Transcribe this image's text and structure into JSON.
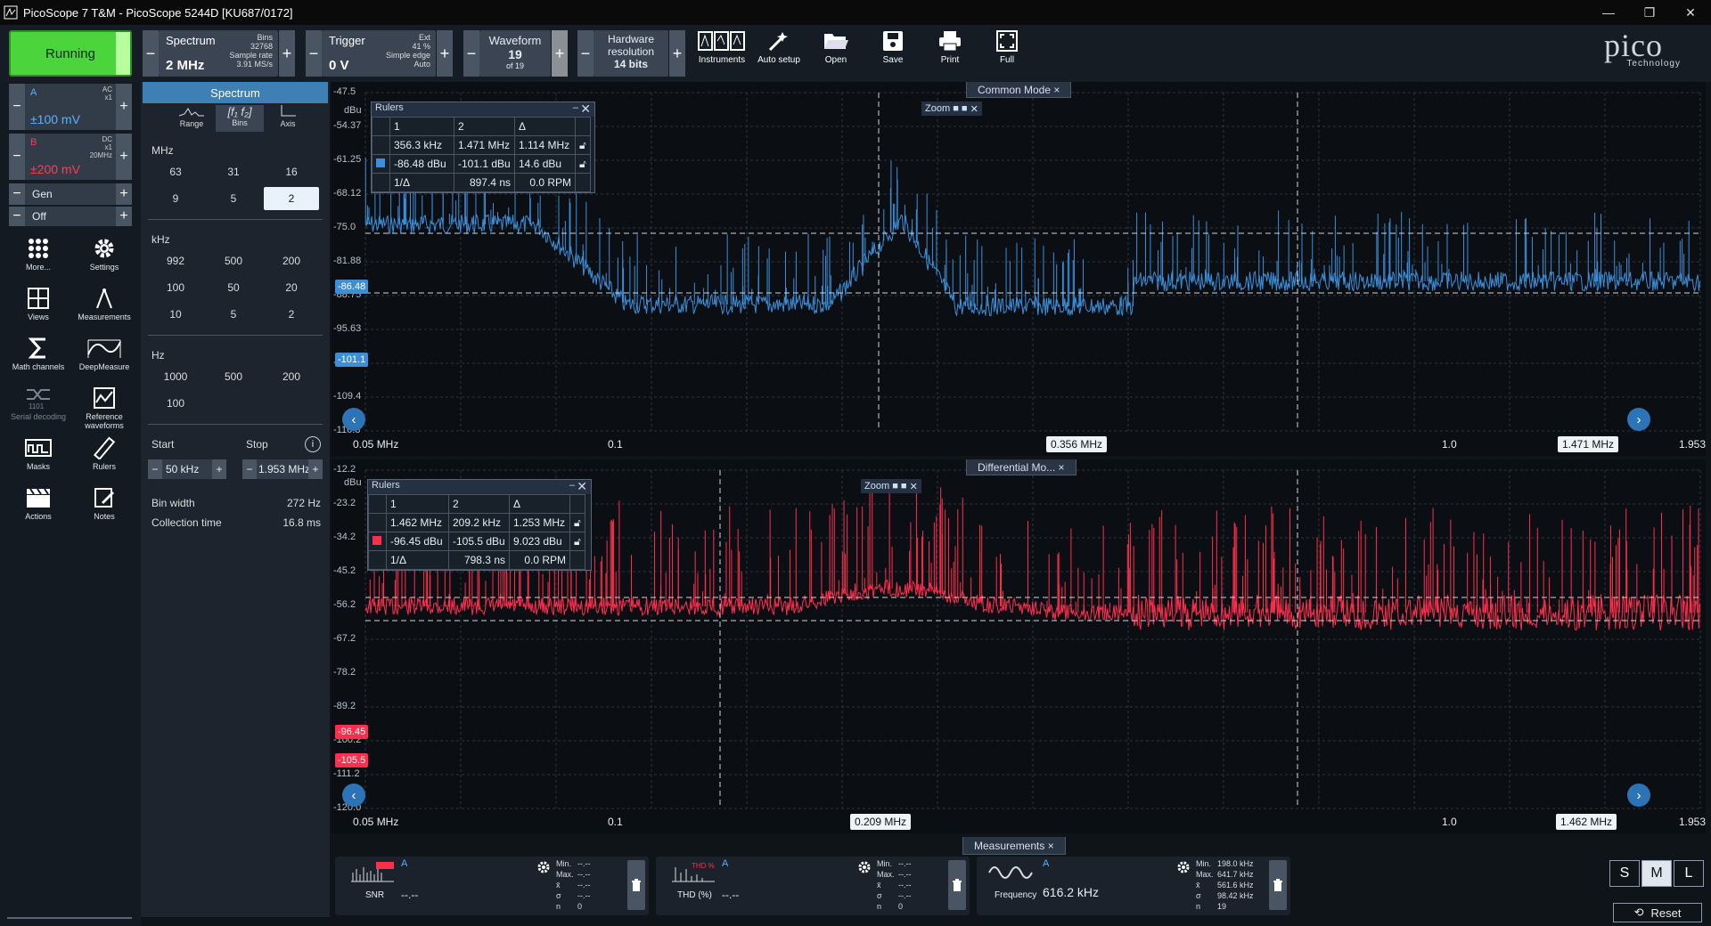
{
  "window": {
    "title": "PicoScope 7 T&M - PicoScope 5244D [KU687/0172]"
  },
  "toolbar": {
    "run": "Running",
    "spectrum": {
      "label": "Spectrum",
      "value": "2 MHz",
      "bins_lbl": "Bins",
      "bins": "32768",
      "rate_lbl": "Sample rate",
      "rate": "3.91 MS/s"
    },
    "trigger": {
      "label": "Trigger",
      "value": "0 V",
      "ext": "Ext",
      "pct": "41 %",
      "edge": "Simple edge",
      "mode": "Auto"
    },
    "waveform": {
      "label": "Waveform",
      "value": "19",
      "of": "of 19"
    },
    "hwres": {
      "label1": "Hardware",
      "label2": "resolution",
      "value": "14 bits"
    },
    "icons": [
      "Instruments",
      "Auto setup",
      "Open",
      "Save",
      "Print",
      "Full"
    ],
    "logo": "pico",
    "logo_sub": "Technology"
  },
  "channels": {
    "a": {
      "name": "A",
      "coupling": "AC",
      "probe": "x1",
      "range": "±100 mV"
    },
    "b": {
      "name": "B",
      "coupling": "DC",
      "probe": "x1",
      "bw": "20MHz",
      "range": "±200 mV"
    },
    "gen": "Gen",
    "off": "Off"
  },
  "nav": [
    "More...",
    "Settings",
    "Views",
    "Measurements",
    "Math channels",
    "DeepMeasure",
    "Serial decoding",
    "Reference waveforms",
    "Masks",
    "Rulers",
    "Actions",
    "Notes"
  ],
  "spectrum_panel": {
    "title": "Spectrum",
    "tabs": [
      "Range",
      "Bins",
      "Axis"
    ],
    "mhz_label": "MHz",
    "mhz": [
      "63",
      "31",
      "16",
      "9",
      "5",
      "2"
    ],
    "khz_label": "kHz",
    "khz": [
      "992",
      "500",
      "200",
      "100",
      "50",
      "20",
      "10",
      "5",
      "2"
    ],
    "hz_label": "Hz",
    "hz": [
      "1000",
      "500",
      "200",
      "100"
    ],
    "start_label": "Start",
    "stop_label": "Stop",
    "start": "50 kHz",
    "stop": "1.953 MHz",
    "binwidth_label": "Bin width",
    "binwidth": "272 Hz",
    "coll_label": "Collection time",
    "coll": "16.8 ms"
  },
  "top_view": {
    "tab": "Common Mode",
    "yunit": "dBu",
    "yticks": [
      "-47.5",
      "-54.37",
      "-61.25",
      "-68.12",
      "-75.0",
      "-81.88",
      "-88.75",
      "-95.63",
      "-102.5",
      "-109.4",
      "-116.3"
    ],
    "xticks": [
      "0.05 MHz",
      "0.1",
      "1.0",
      "1.953"
    ],
    "ruler_tags": {
      "x1": "0.356 MHz",
      "x2": "1.471 MHz",
      "y1": "-86.48",
      "y2": "-101.1"
    },
    "rulers": {
      "title": "Rulers",
      "h": [
        "1",
        "2",
        "Δ"
      ],
      "f": [
        "356.3 kHz",
        "1.471 MHz",
        "1.114 MHz"
      ],
      "a": [
        "-86.48 dBu",
        "-101.1 dBu",
        "14.6 dBu"
      ],
      "inv": [
        "1/Δ",
        "897.4 ns",
        "0.0 RPM"
      ]
    },
    "zoom": "Zoom",
    "color": "#3b8fd9"
  },
  "bottom_view": {
    "tab": "Differential Mo...",
    "yunit": "dBu",
    "yticks": [
      "-12.2",
      "-23.2",
      "-34.2",
      "-45.2",
      "-56.2",
      "-67.2",
      "-78.2",
      "-89.2",
      "-100.2",
      "-111.2",
      "-120.0"
    ],
    "xticks": [
      "0.05 MHz",
      "0.1",
      "1.0",
      "1.953"
    ],
    "ruler_tags": {
      "x1": "0.209 MHz",
      "x2": "1.462 MHz",
      "y1": "-96.45",
      "y2": "-105.5"
    },
    "rulers": {
      "title": "Rulers",
      "h": [
        "1",
        "2",
        "Δ"
      ],
      "f": [
        "1.462 MHz",
        "209.2 kHz",
        "1.253 MHz"
      ],
      "a": [
        "-96.45 dBu",
        "-105.5 dBu",
        "9.023 dBu"
      ],
      "inv": [
        "1/Δ",
        "798.3 ns",
        "0.0 RPM"
      ]
    },
    "zoom": "Zoom",
    "color": "#ff2e4d"
  },
  "measurements": {
    "tab": "Measurements",
    "items": [
      {
        "name": "SNR",
        "ch": "A",
        "value": "--.--",
        "stats": [
          "Min.",
          "Max.",
          "x̄",
          "σ",
          "n"
        ],
        "vals": [
          "--.--",
          "--.--",
          "--.--",
          "--.--",
          "0"
        ]
      },
      {
        "name": "THD (%)",
        "ch": "A",
        "value": "--.--",
        "stats": [
          "Min.",
          "Max.",
          "x̄",
          "σ",
          "n"
        ],
        "vals": [
          "--.--",
          "--.--",
          "--.--",
          "--.--",
          "0"
        ]
      },
      {
        "name": "Frequency",
        "ch": "A",
        "value": "616.2 kHz",
        "stats": [
          "Min.",
          "Max.",
          "x̄",
          "σ",
          "n"
        ],
        "vals": [
          "198.0 kHz",
          "641.7 kHz",
          "561.6 kHz",
          "98.42 kHz",
          "19"
        ]
      }
    ]
  },
  "sml": [
    "S",
    "M",
    "L"
  ],
  "reset": "Reset"
}
